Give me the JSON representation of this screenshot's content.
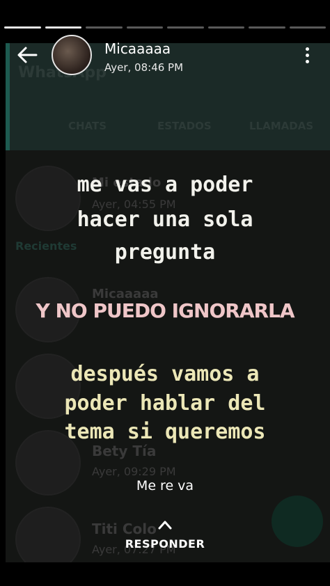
{
  "header": {
    "contact_name": "Micaaaaa",
    "timestamp": "Ayer, 08:46 PM"
  },
  "story": {
    "lines_white": [
      "me vas a poder",
      "hacer una sola",
      "pregunta"
    ],
    "highlight_line": "Y NO PUEDO IGNORARLA",
    "lines_cream": [
      "después vamos a",
      "poder hablar del",
      "tema si queremos"
    ]
  },
  "reply": {
    "received_text": "Me re va",
    "respond_label": "RESPONDER"
  },
  "background": {
    "app_title": "WhatsApp",
    "tabs": [
      "CHATS",
      "ESTADOS",
      "LLAMADAS"
    ],
    "my_status_name": "Mi estado",
    "my_status_time": "Ayer, 04:55 PM",
    "recent_header": "Recientes",
    "contacts": [
      {
        "name": "Micaaaaa",
        "time": ""
      },
      {
        "name": "",
        "time": ""
      },
      {
        "name": "Bety Tía",
        "time": "Ayer, 09:29 PM"
      },
      {
        "name": "Titi Colo",
        "time": "Ayer, 07:27 PM"
      }
    ]
  },
  "colors": {
    "highlight": "#efc6c8",
    "cream": "#ece7b7",
    "overlay": "#141614"
  }
}
